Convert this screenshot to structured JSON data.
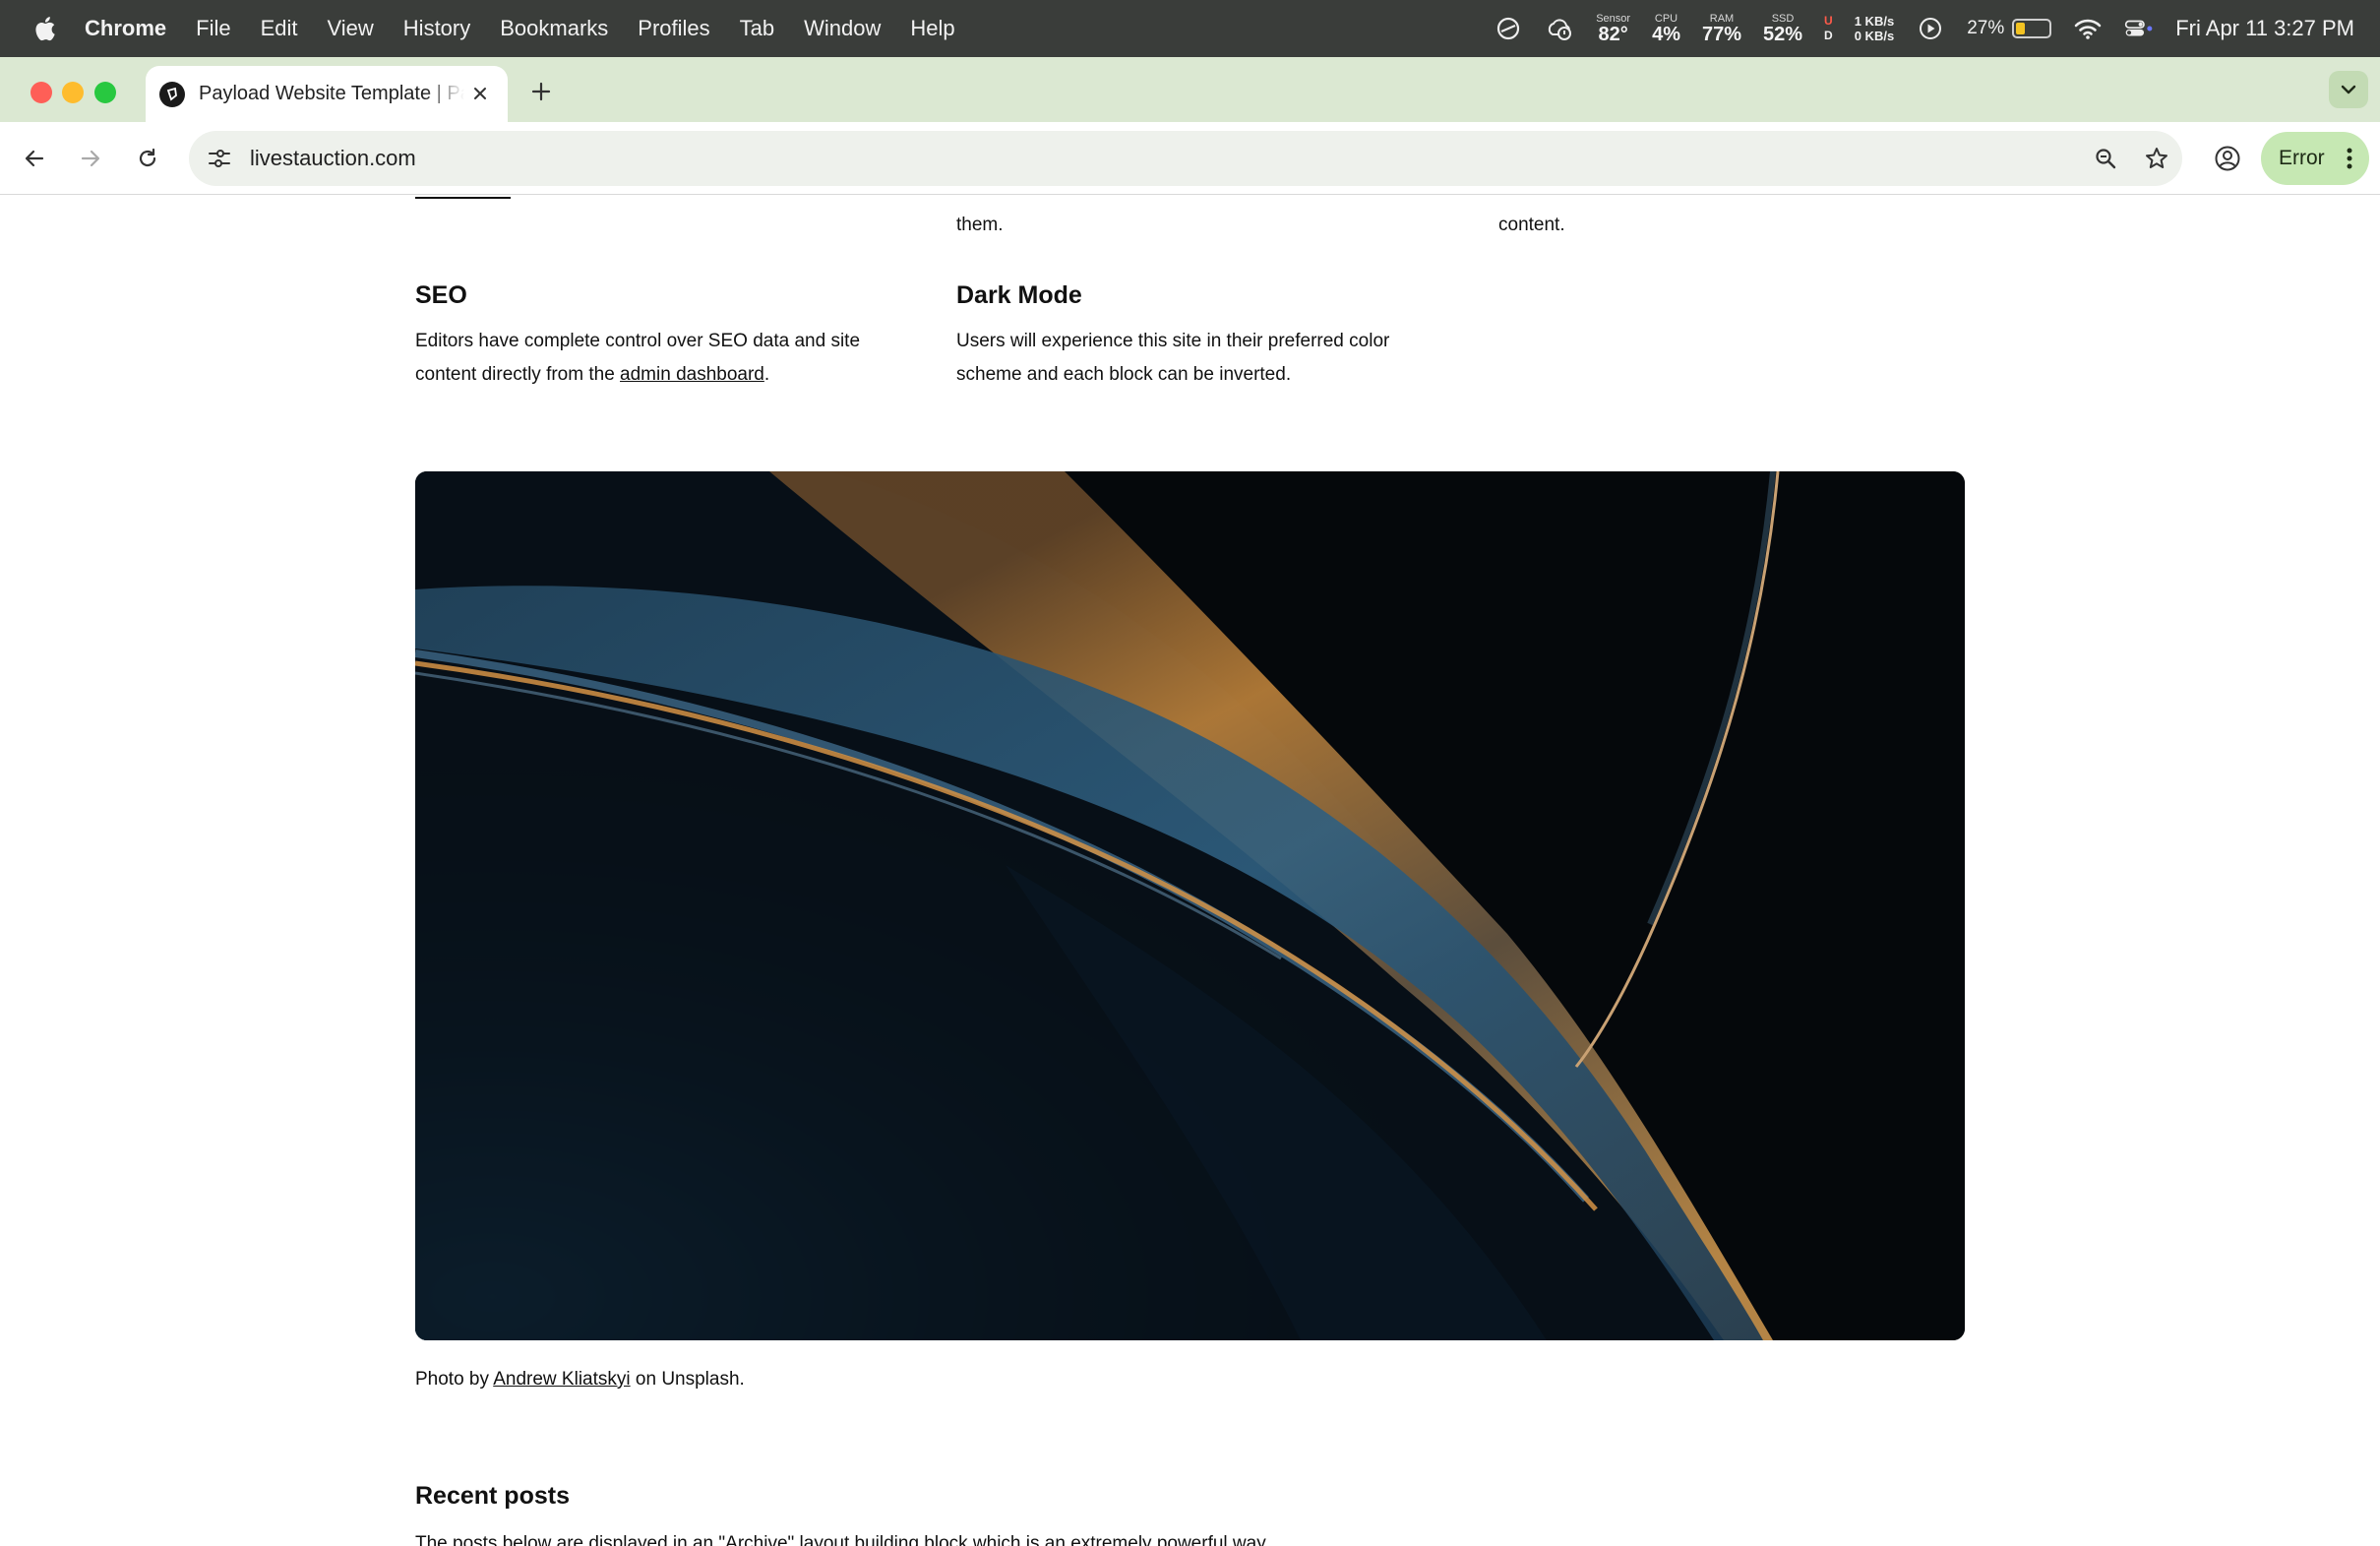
{
  "menubar": {
    "app_name": "Chrome",
    "items": [
      "File",
      "Edit",
      "View",
      "History",
      "Bookmarks",
      "Profiles",
      "Tab",
      "Window",
      "Help"
    ],
    "stats": {
      "sensor_label": "Sensor",
      "sensor_value": "82°",
      "cpu_label": "CPU",
      "cpu_value": "4%",
      "ram_label": "RAM",
      "ram_value": "77%",
      "ssd_label": "SSD",
      "ssd_value": "52%",
      "u_label": "U",
      "d_label": "D",
      "net_up": "1 KB/s",
      "net_down": "0 KB/s"
    },
    "battery_percent": "27%",
    "battery_level": 0.27,
    "datetime": "Fri Apr 11  3:27 PM"
  },
  "browser": {
    "tab_title": "Payload Website Template | Payload",
    "url": "livestauction.com",
    "error_label": "Error"
  },
  "page": {
    "fragment_mid": "them.",
    "fragment_right": "content.",
    "features": [
      {
        "title": "SEO",
        "text_before": "Editors have complete control over SEO data and site content directly from the ",
        "link": "admin dashboard",
        "text_after": "."
      },
      {
        "title": "Dark Mode",
        "text": "Users will experience this site in their preferred color scheme and each block can be inverted."
      }
    ],
    "caption": {
      "prefix": "Photo by ",
      "author": "Andrew Kliatskyi",
      "suffix": " on Unsplash."
    },
    "recent_posts_title": "Recent posts",
    "recent_posts_desc": "The posts below are displayed in an \"Archive\" layout building block which is an extremely powerful way"
  },
  "colors": {
    "menubar_bg": "#3a3d3a",
    "tabstrip_bg": "#dbe8d2",
    "error_button_bg": "#c6e8b3",
    "hero_gold": "#d89a45",
    "hero_blue": "#2b5373"
  }
}
